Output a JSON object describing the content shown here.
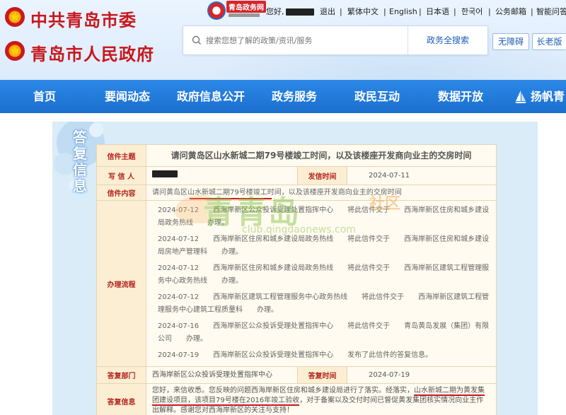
{
  "header": {
    "org_cpc": "中共青岛市委",
    "org_gov": "青岛市人民政府",
    "logo_text": "青岛政务网",
    "greeting": "您好,",
    "links": [
      "退出",
      "繁体中文",
      "English",
      "日本语",
      "한국어",
      "公务邮箱",
      "智能问答"
    ],
    "search_placeholder": "搜索您想了解的政策/资讯/服务",
    "search_button": "政务全搜索",
    "accessibility": "无障碍",
    "elder_mode": "长老版"
  },
  "nav": [
    "首页",
    "要闻动态",
    "政府信息公开",
    "政务服务",
    "政民互动",
    "数据开放",
    "扬帆青"
  ],
  "panel_title": "答复信息",
  "letter": {
    "subject_label": "信件主题",
    "subject": "请问黄岛区山水新城二期79号楼竣工时间，以及该楼座开发商向业主的交房时间",
    "writer_label": "写 信 人",
    "sent_time_label": "发信时间",
    "sent_time": "2024-07-11",
    "content_label": "信件内容",
    "content": "请问黄岛区山水新城二期79号楼竣工时间，以及该楼座开发商向业主的交房时间",
    "process_label": "办理流程",
    "process": [
      "2024-07-12　　西海岸新区公众投诉受理处置指挥中心　　将此信件交于　　西海岸新区住房和城乡建设局政务热线　　办理。",
      "2024-07-12　　西海岸新区住房和城乡建设局政务热线　　将此信件交于　　西海岸新区住房和城乡建设局房地产管理科　　办理。",
      "2024-07-12　　西海岸新区住房和城乡建设局政务热线　　将此信件交于　　西海岸新区建筑工程管理服务中心政务热线　　办理。",
      "2024-07-12　　西海岸新区建筑工程管理服务中心政务热线　　将此信件交于　　西海岸新区建筑工程管理服务中心建筑工程质量科　　办理。",
      "2024-07-16　　西海岸新区公众投诉受理处置指挥中心　　将此信件交于　　青岛黄岛发展（集团）有限公司　　办理。",
      "2024-07-19　　西海岸新区公众投诉受理处置指挥中心　　发布了此信件的答复信息。"
    ],
    "reply_dept_label": "答复部门",
    "reply_dept": "西海岸新区公众投诉受理处置指挥中心",
    "reply_time_label": "答复时间",
    "reply_time": "2024-07-19",
    "reply_label": "答复信息",
    "reply_part1": "您好，来信收悉。您反映的问题西海岸新区住房和城乡建设局进行了落实。经落实，",
    "reply_part2": "山水新城二期为黄发集团建设项目，该项目79号楼在2016年竣工验收",
    "reply_part3": "，对于备案以及交付时间已督促黄发集团核实情况向业主作出解释。感谢您对西海岸新区的关注与支持！"
  },
  "watermark": {
    "brand": "青青岛",
    "tag": "社区",
    "url": "club.qingdaonews.com"
  },
  "colors": {
    "nav_blue": "#1b6fcf",
    "title_red": "#c8171d",
    "label_bg": "#fbeed3"
  }
}
